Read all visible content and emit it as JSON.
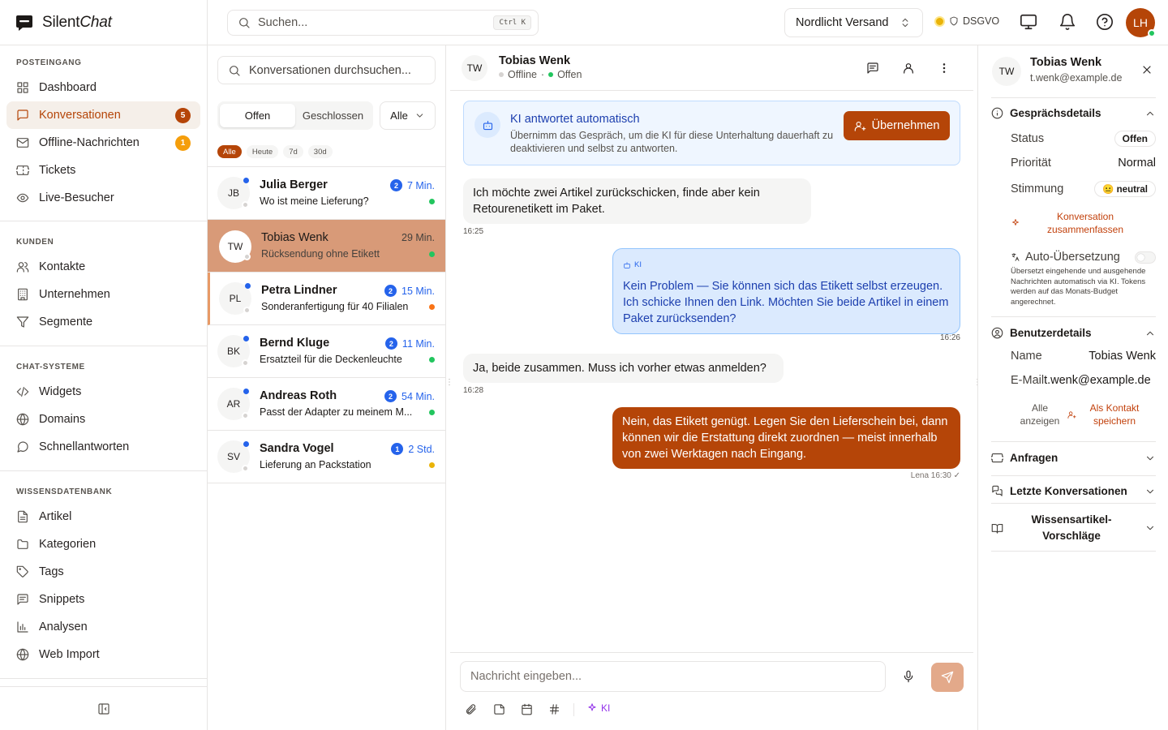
{
  "app": {
    "name_a": "Silent",
    "name_b": "Chat"
  },
  "sidebar": {
    "groups": [
      {
        "title": "POSTEINGANG",
        "items": [
          {
            "label": "Dashboard"
          },
          {
            "label": "Konversationen",
            "badge": "5"
          },
          {
            "label": "Offline-Nachrichten",
            "badge": "1"
          },
          {
            "label": "Tickets"
          },
          {
            "label": "Live-Besucher"
          }
        ]
      },
      {
        "title": "KUNDEN",
        "items": [
          {
            "label": "Kontakte"
          },
          {
            "label": "Unternehmen"
          },
          {
            "label": "Segmente"
          }
        ]
      },
      {
        "title": "CHAT-SYSTEME",
        "items": [
          {
            "label": "Widgets"
          },
          {
            "label": "Domains"
          },
          {
            "label": "Schnellantworten"
          }
        ]
      },
      {
        "title": "WISSENSDATENBANK",
        "items": [
          {
            "label": "Artikel"
          },
          {
            "label": "Kategorien"
          },
          {
            "label": "Tags"
          },
          {
            "label": "Snippets"
          },
          {
            "label": "Analysen"
          },
          {
            "label": "Web Import"
          }
        ]
      }
    ]
  },
  "topbar": {
    "search_placeholder": "Suchen...",
    "shortcut": "Ctrl K",
    "org": "Nordlicht Versand",
    "gdpr": "DSGVO",
    "avatar": "LH"
  },
  "convlist": {
    "search_placeholder": "Konversationen durchsuchen...",
    "tabs": [
      "Offen",
      "Geschlossen"
    ],
    "filter": "Alle",
    "chips": [
      "Alle",
      "Heute",
      "7d",
      "30d"
    ],
    "items": [
      {
        "initials": "JB",
        "name": "Julia Berger",
        "preview": "Wo ist meine Lieferung?",
        "time": "7 Min.",
        "count": "2",
        "status_color": "#22c55e"
      },
      {
        "initials": "TW",
        "name": "Tobias Wenk",
        "preview": "Rücksendung ohne Etikett",
        "time": "29 Min.",
        "count": "",
        "status_color": "#22c55e"
      },
      {
        "initials": "PL",
        "name": "Petra Lindner",
        "preview": "Sonderanfertigung für 40 Filialen",
        "time": "15 Min.",
        "count": "2",
        "status_color": "#f97316"
      },
      {
        "initials": "BK",
        "name": "Bernd Kluge",
        "preview": "Ersatzteil für die Deckenleuchte",
        "time": "11 Min.",
        "count": "2",
        "status_color": "#22c55e"
      },
      {
        "initials": "AR",
        "name": "Andreas Roth",
        "preview": "Passt der Adapter zu meinem M...",
        "time": "54 Min.",
        "count": "2",
        "status_color": "#22c55e"
      },
      {
        "initials": "SV",
        "name": "Sandra Vogel",
        "preview": "Lieferung an Packstation",
        "time": "2 Std.",
        "count": "1",
        "status_color": "#eab308"
      }
    ]
  },
  "chat": {
    "initials": "TW",
    "name": "Tobias Wenk",
    "presence": "Offline",
    "state": "Offen",
    "banner_title": "KI antwortet automatisch",
    "banner_body": "Übernimm das Gespräch, um die KI für diese Unterhaltung dauerhaft zu deaktivieren und selbst zu antworten.",
    "takeover": "Übernehmen",
    "messages": [
      {
        "text": "Ich möchte zwei Artikel zurückschicken, finde aber kein Retourenetikett im Paket.",
        "time": "16:25"
      },
      {
        "label": "KI",
        "text": "Kein Problem — Sie können sich das Etikett selbst erzeugen. Ich schicke Ihnen den Link. Möchten Sie beide Artikel in einem Paket zurücksenden?",
        "time": "16:26"
      },
      {
        "text": "Ja, beide zusammen. Muss ich vorher etwas anmelden?",
        "time": "16:28"
      },
      {
        "text": "Nein, das Etikett genügt. Legen Sie den Lieferschein bei, dann können wir die Erstattung direkt zuordnen — meist innerhalb von zwei Werktagen nach Eingang.",
        "time": "Lena 16:30 ✓"
      }
    ],
    "input_placeholder": "Nachricht eingeben...",
    "ki_button": "KI"
  },
  "details": {
    "initials": "TW",
    "name": "Tobias Wenk",
    "email": "t.wenk@example.de",
    "conv_title": "Gesprächsdetails",
    "status_label": "Status",
    "status_value": "Offen",
    "priority_label": "Priorität",
    "priority_value": "Normal",
    "mood_label": "Stimmung",
    "mood_value": "neutral",
    "summarize": "Konversation zusammenfassen",
    "translate_title": "Auto-Übersetzung",
    "translate_desc": "Übersetzt eingehende und ausgehende Nachrichten automatisch via KI. Tokens werden auf das Monats-Budget angerechnet.",
    "user_title": "Benutzerdetails",
    "name_label": "Name",
    "name_value": "Tobias Wenk",
    "email_label": "E-Mail",
    "email_value": "t.wenk@example.de",
    "show_all": "Alle anzeigen",
    "save_contact": "Als Kontakt speichern",
    "requests": "Anfragen",
    "recent": "Letzte Konversationen",
    "articles": "Wissensartikel-Vorschläge"
  }
}
